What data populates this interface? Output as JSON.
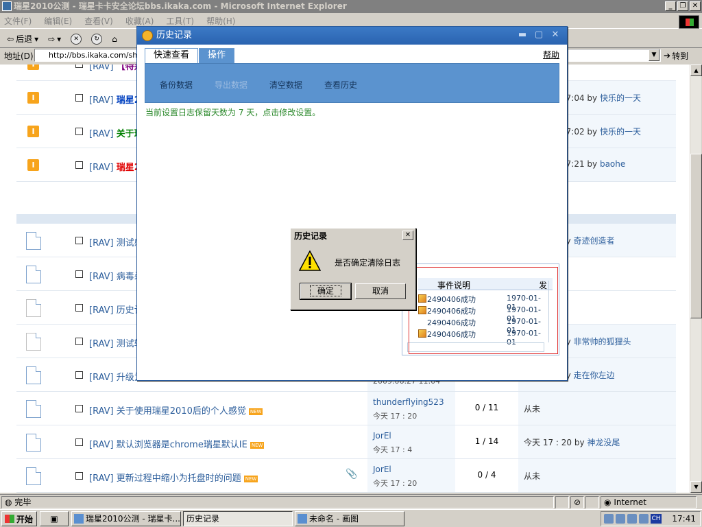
{
  "ie": {
    "title": "瑞星2010公测 - 瑞星卡卡安全论坛bbs.ikaka.com - Microsoft Internet Explorer",
    "menu": [
      "文件(F)",
      "编辑(E)",
      "查看(V)",
      "收藏(A)",
      "工具(T)",
      "帮助(H)"
    ],
    "back_label": "后退",
    "address_label": "地址(D)",
    "address_value": "http://bbs.ikaka.com/show",
    "go_label": "转到"
  },
  "forum": {
    "rows": [
      {
        "type": "pin",
        "prefix": "[RAV]",
        "title": "【特别",
        "color": "purple"
      },
      {
        "type": "pin",
        "prefix": "[RAV]",
        "title": "瑞星2",
        "color": "blue",
        "last_time": "17:04",
        "last_by": "快乐的一天"
      },
      {
        "type": "pin",
        "prefix": "[RAV]",
        "title": "关于瑞",
        "color": "green",
        "last_time": "17:02",
        "last_by": "快乐的一天"
      },
      {
        "type": "pin",
        "prefix": "[RAV]",
        "title": "瑞星2",
        "color": "red",
        "last_time": "17:21",
        "last_by": "baohe"
      },
      {
        "type": "doc",
        "prefix": "[RAV]",
        "title": "测试感",
        "last_by": "奇迹创造者"
      },
      {
        "type": "doc",
        "prefix": "[RAV]",
        "title": "病毒杀"
      },
      {
        "type": "docgray",
        "prefix": "[RAV]",
        "title": "历史记"
      },
      {
        "type": "docgray",
        "prefix": "[RAV]",
        "title": "测试轻",
        "last_by": "非常帅的狐狸头"
      },
      {
        "type": "doc",
        "prefix": "[RAV]",
        "title": "升级为",
        "author_time": "2009.06.27 11:04",
        "last_by": "走在你左边"
      },
      {
        "type": "doc",
        "prefix": "[RAV]",
        "title": "关于使用瑞星2010后的个人感觉",
        "new": "NEW",
        "author": "thunderflying523",
        "author_time": "今天 17 : 20",
        "count": "0 / 11",
        "last": "从未"
      },
      {
        "type": "doc",
        "prefix": "[RAV]",
        "title": "默认浏览器是chrome瑞星默认IE",
        "new": "NEW",
        "author": "JorEl",
        "author_time": "今天 17 : 4",
        "count": "1 / 14",
        "last": "今天 17 : 20 by",
        "last_by": "神龙没尾"
      },
      {
        "type": "doc",
        "prefix": "[RAV]",
        "title": "更新过程中缩小为托盘时的问题",
        "new": "NEW",
        "author": "JorEl",
        "author_time": "今天 17 : 20",
        "count": "0 / 4",
        "last": "从未",
        "attach": true
      }
    ]
  },
  "status": {
    "left": "完毕",
    "zone": "Internet"
  },
  "taskbar": {
    "start": "开始",
    "tasks": [
      "瑞星2010公测 - 瑞星卡...",
      "历史记录",
      "未命名 - 画图"
    ],
    "lang": "CH",
    "clock": "17:41"
  },
  "history": {
    "title": "历史记录",
    "tabs": [
      "快速查看",
      "操作"
    ],
    "help": "帮助",
    "actions": [
      {
        "label": "备份数据",
        "enabled": true
      },
      {
        "label": "导出数据",
        "enabled": false
      },
      {
        "label": "清空数据",
        "enabled": true
      },
      {
        "label": "查看历史",
        "enabled": true
      }
    ],
    "note": "当前设置日志保留天数为 7 天，点击修改设置。",
    "event_columns": [
      "事件说明",
      "发"
    ],
    "events": [
      {
        "desc": "2490406成功",
        "time": "1970-01-01"
      },
      {
        "desc": "2490406成功",
        "time": "1970-01-01"
      },
      {
        "desc": "2490406成功",
        "time": "1970-01-01"
      },
      {
        "desc": "2490406成功",
        "time": "1970-01-01"
      }
    ]
  },
  "dialog": {
    "title": "历史记录",
    "message": "是否确定清除日志",
    "ok": "确定",
    "cancel": "取消"
  }
}
